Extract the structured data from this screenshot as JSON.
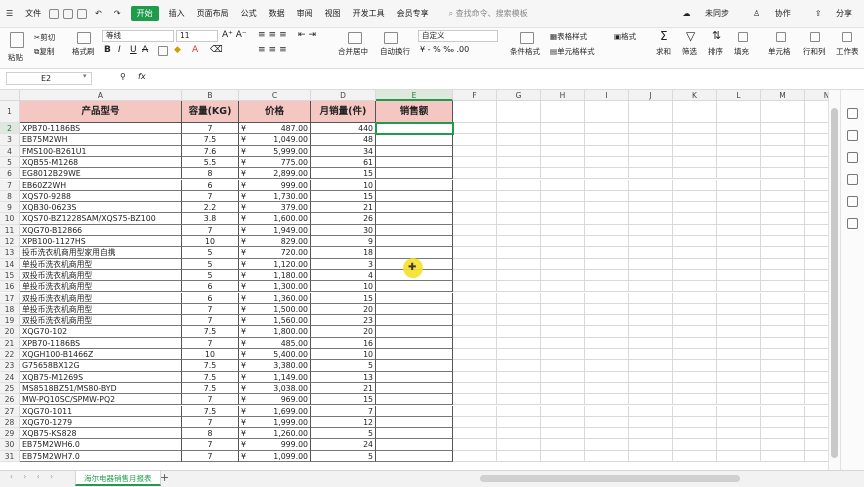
{
  "menu": {
    "file": "文件",
    "home": "开始",
    "tabs": [
      "插入",
      "页面布局",
      "公式",
      "数据",
      "审阅",
      "视图",
      "开发工具",
      "会员专享"
    ],
    "search": "查找命令、搜索模板",
    "sync": "未同步",
    "collab": "协作",
    "share": "分享"
  },
  "ribbon": {
    "paste": "粘贴",
    "cut": "剪切",
    "copy": "复制",
    "format_painter": "格式刷",
    "font_name": "等线",
    "font_size": "11",
    "merge": "合并居中",
    "wrap": "自动换行",
    "number_format": "自定义",
    "cond_format": "条件格式",
    "table_style": "表格样式",
    "cell_style": "单元格样式",
    "format": "格式",
    "sum": "求和",
    "filter": "筛选",
    "sort": "排序",
    "fill": "填充",
    "cell": "单元格",
    "rowcol": "行和列",
    "worksheet": "工作表"
  },
  "formula_bar": {
    "cell_ref": "E2",
    "fx": "fx",
    "content": ""
  },
  "columns": [
    "A",
    "B",
    "C",
    "D",
    "E",
    "F",
    "G",
    "H",
    "I",
    "J",
    "K",
    "L",
    "M",
    "N"
  ],
  "headers": {
    "model": "产品型号",
    "capacity": "容量(KG)",
    "price": "价格",
    "monthly_sales": "月销量(件)",
    "revenue": "销售额"
  },
  "currency_symbol": "¥",
  "rows": [
    {
      "model": "XPB70-1186BS",
      "capacity": "7",
      "price": "487.00",
      "sales": "440"
    },
    {
      "model": "EB75M2WH",
      "capacity": "7.5",
      "price": "1,049.00",
      "sales": "48"
    },
    {
      "model": "FMS100-B261U1",
      "capacity": "7.6",
      "price": "5,999.00",
      "sales": "34"
    },
    {
      "model": "XQB55-M1268",
      "capacity": "5.5",
      "price": "775.00",
      "sales": "61"
    },
    {
      "model": "EG8012B29WE",
      "capacity": "8",
      "price": "2,899.00",
      "sales": "15"
    },
    {
      "model": "EB60Z2WH",
      "capacity": "6",
      "price": "999.00",
      "sales": "10"
    },
    {
      "model": "XQS70-9288",
      "capacity": "7",
      "price": "1,730.00",
      "sales": "15"
    },
    {
      "model": "XQB30-0623S",
      "capacity": "2.2",
      "price": "379.00",
      "sales": "21"
    },
    {
      "model": "XQS70-BZ1228SAM/XQS75-BZ100",
      "capacity": "3.8",
      "price": "1,600.00",
      "sales": "26"
    },
    {
      "model": "XQG70-B12866",
      "capacity": "7",
      "price": "1,949.00",
      "sales": "30"
    },
    {
      "model": "XPB100-1127HS",
      "capacity": "10",
      "price": "829.00",
      "sales": "9"
    },
    {
      "model": "投币洗衣机商用型家用自携",
      "capacity": "5",
      "price": "720.00",
      "sales": "18"
    },
    {
      "model": "单投币洗衣机商用型",
      "capacity": "5",
      "price": "1,120.00",
      "sales": "3"
    },
    {
      "model": "双投币洗衣机商用型",
      "capacity": "5",
      "price": "1,180.00",
      "sales": "4"
    },
    {
      "model": "单投币洗衣机商用型",
      "capacity": "6",
      "price": "1,300.00",
      "sales": "10"
    },
    {
      "model": "双投币洗衣机商用型",
      "capacity": "6",
      "price": "1,360.00",
      "sales": "15"
    },
    {
      "model": "单投币洗衣机商用型",
      "capacity": "7",
      "price": "1,500.00",
      "sales": "20"
    },
    {
      "model": "双投币洗衣机商用型",
      "capacity": "7",
      "price": "1,560.00",
      "sales": "23"
    },
    {
      "model": "XQG70-102",
      "capacity": "7.5",
      "price": "1,800.00",
      "sales": "20"
    },
    {
      "model": "XPB70-1186BS",
      "capacity": "7",
      "price": "485.00",
      "sales": "16"
    },
    {
      "model": "XQGH100-B1466Z",
      "capacity": "10",
      "price": "5,400.00",
      "sales": "10"
    },
    {
      "model": "G75658BX12G",
      "capacity": "7.5",
      "price": "3,380.00",
      "sales": "5"
    },
    {
      "model": "XQB75-M1269S",
      "capacity": "7.5",
      "price": "1,149.00",
      "sales": "13"
    },
    {
      "model": "MS8518BZ51/MS80-BYD",
      "capacity": "7.5",
      "price": "3,038.00",
      "sales": "21"
    },
    {
      "model": "MW-PQ10SC/SPMW-PQ2",
      "capacity": "7",
      "price": "969.00",
      "sales": "15"
    },
    {
      "model": "XQG70-1011",
      "capacity": "7.5",
      "price": "1,699.00",
      "sales": "7"
    },
    {
      "model": "XQG70-1279",
      "capacity": "7",
      "price": "1,999.00",
      "sales": "12"
    },
    {
      "model": "XQB75-KS828",
      "capacity": "8",
      "price": "1,260.00",
      "sales": "5"
    },
    {
      "model": "EB75M2WH6.0",
      "capacity": "7",
      "price": "999.00",
      "sales": "24"
    },
    {
      "model": "EB75M2WH7.0",
      "capacity": "7",
      "price": "1,099.00",
      "sales": "5"
    }
  ],
  "sheet_tab": "海尔电器销售月报表",
  "add_sheet": "+",
  "colors": {
    "accent": "#1f9b4b",
    "header_fill": "#f4c7c3"
  }
}
